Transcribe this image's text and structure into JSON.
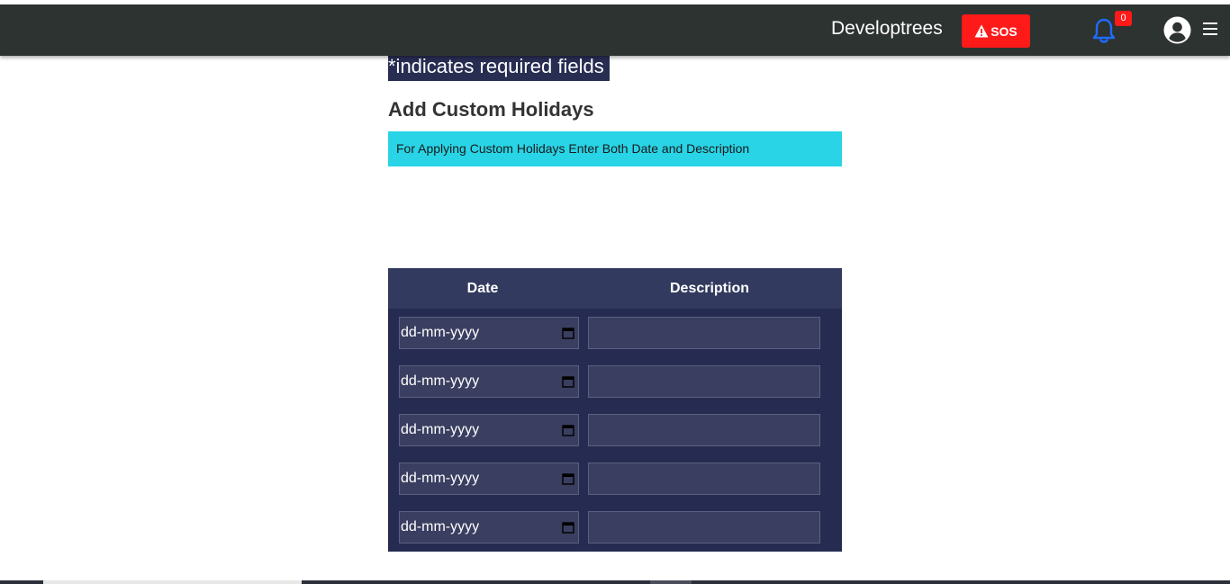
{
  "navbar": {
    "brand": "Developtrees",
    "sos_label": "SOS",
    "notification_count": "0",
    "icons": {
      "sos": "warning-triangle-icon",
      "notifications": "bell-icon",
      "profile": "user-circle-icon",
      "menu": "hamburger-menu-icon"
    },
    "colors": {
      "background": "#2d3331",
      "sos": "#ff1a1a",
      "bell": "#1e6cff"
    }
  },
  "form": {
    "required_note": "*indicates required fields",
    "section_title": "Add Custom Holidays",
    "info_text": "For Applying Custom Holidays Enter Both Date and Description",
    "colors": {
      "info_banner": "#28d4e6",
      "table_header": "#323a5f",
      "table_body": "#262c51"
    }
  },
  "table": {
    "headers": [
      "Date",
      "Description"
    ],
    "date_placeholder": "dd-mm-yyyy",
    "rows": [
      {
        "date": "",
        "description": ""
      },
      {
        "date": "",
        "description": ""
      },
      {
        "date": "",
        "description": ""
      },
      {
        "date": "",
        "description": ""
      },
      {
        "date": "",
        "description": ""
      }
    ]
  }
}
